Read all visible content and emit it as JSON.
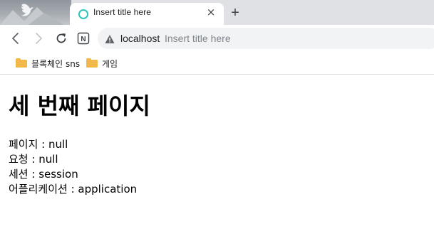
{
  "browser": {
    "tab": {
      "title": "Insert title here",
      "close_glyph": "×"
    },
    "new_tab_glyph": "+",
    "toolbar": {
      "back_icon": "back-arrow-icon",
      "forward_icon": "forward-arrow-icon",
      "reload_icon": "reload-icon",
      "extension_icon": "n-extension-icon",
      "extension_letter": "N"
    },
    "omnibox": {
      "security_icon": "warning-triangle-icon",
      "host": "localhost",
      "page_title": "Insert title here"
    },
    "bookmarks": [
      {
        "label": "블록체인 sns",
        "icon": "folder-icon"
      },
      {
        "label": "게임",
        "icon": "folder-icon"
      }
    ]
  },
  "page": {
    "heading": "세 번째 페이지",
    "lines": [
      "페이지 : null",
      "요청 : null",
      "세션 : session",
      "어플리케이션 : application"
    ]
  },
  "colors": {
    "tabstrip": "#dfe1e5",
    "tab_favicon": "#2ec4b6",
    "folder": "#f2b84b",
    "omnibox": "#f1f3f4"
  }
}
